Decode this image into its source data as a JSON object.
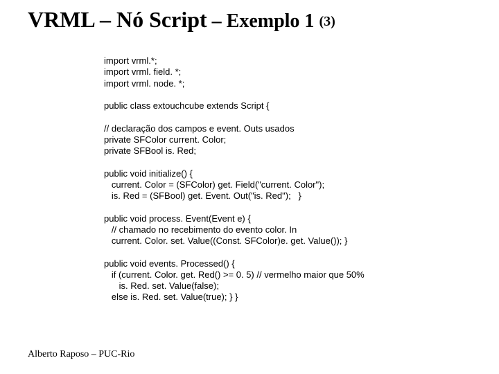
{
  "title": {
    "part1": "VRML – Nó Script",
    "part2": " – Exemplo 1 ",
    "part3": "(3)"
  },
  "code": {
    "line01": "import vrml.*;",
    "line02": "import vrml. field. *;",
    "line03": "import vrml. node. *;",
    "blank1": "",
    "line04": "public class extouchcube extends Script {",
    "blank2": "",
    "line05": "// declaração dos campos e event. Outs usados",
    "line06": "private SFColor current. Color;",
    "line07": "private SFBool is. Red;",
    "blank3": "",
    "line08": "public void initialize() {",
    "line09": "   current. Color = (SFColor) get. Field(\"current. Color\");",
    "line10": "   is. Red = (SFBool) get. Event. Out(\"is. Red\");   }",
    "blank4": "",
    "line11": "public void process. Event(Event e) {",
    "line12": "   // chamado no recebimento do evento color. In",
    "line13": "   current. Color. set. Value((Const. SFColor)e. get. Value()); }",
    "blank5": "",
    "line14": "public void events. Processed() {",
    "line15": "   if (current. Color. get. Red() >= 0. 5) // vermelho maior que 50%",
    "line16": "      is. Red. set. Value(false);",
    "line17": "   else is. Red. set. Value(true); } }"
  },
  "footer": "Alberto Raposo – PUC-Rio"
}
